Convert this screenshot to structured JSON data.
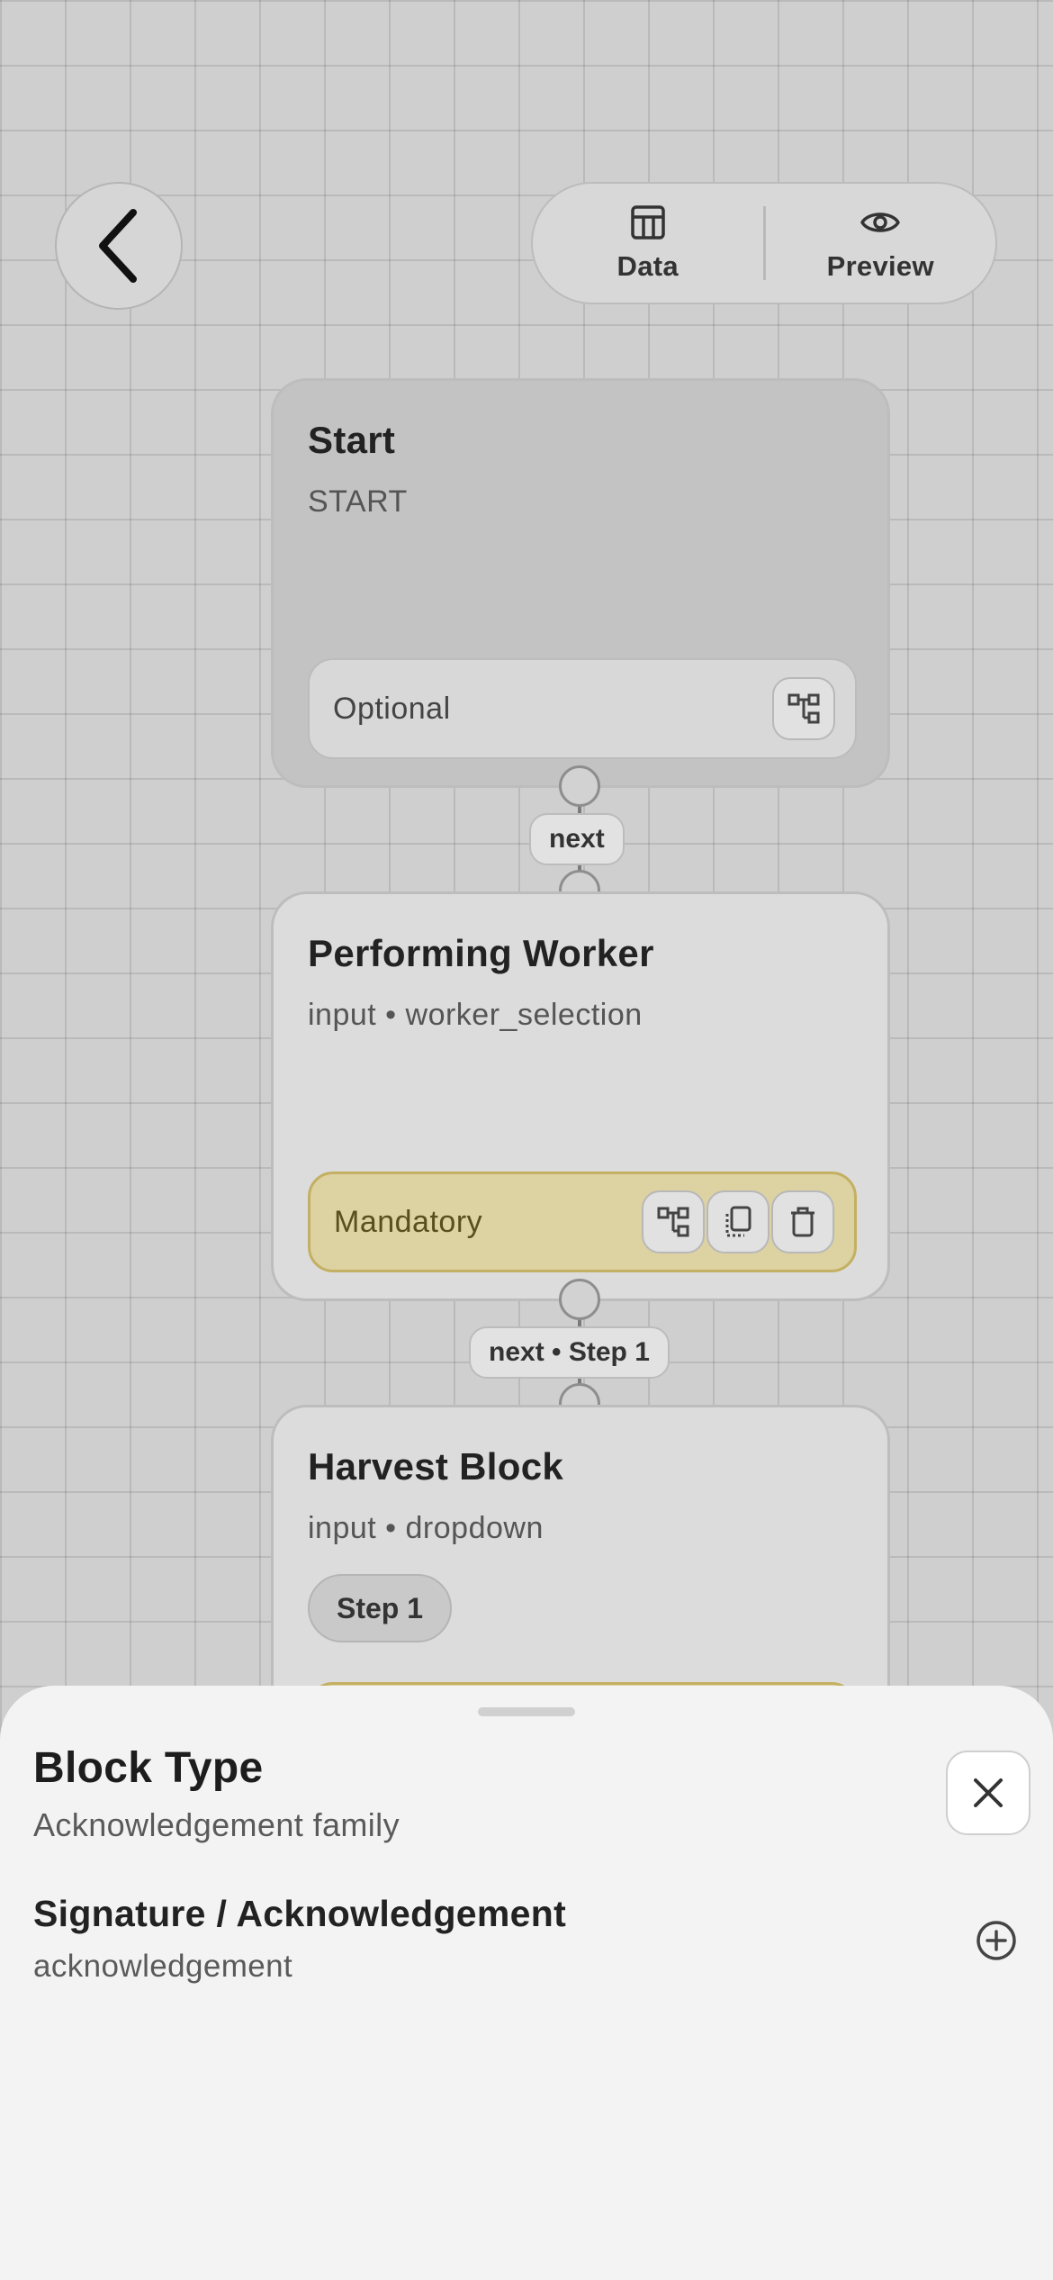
{
  "toolbar": {
    "back_icon": "chevron-left-icon",
    "data_label": "Data",
    "data_icon": "table-icon",
    "preview_label": "Preview",
    "preview_icon": "eye-icon"
  },
  "blocks": [
    {
      "title": "Start",
      "subtitle": "START",
      "footer_label": "Optional"
    },
    {
      "title": "Performing Worker",
      "subtitle": "input • worker_selection",
      "footer_label": "Mandatory"
    },
    {
      "title": "Harvest Block",
      "subtitle": "input • dropdown",
      "chip": "Step 1"
    }
  ],
  "edges": [
    {
      "label": "next"
    },
    {
      "label": "next • Step 1"
    }
  ],
  "colors": {
    "canvas_bg": "#cfcfcf",
    "start_block": "#c3c3c3",
    "block": "#dcdcdc",
    "mandatory_bg": "#dcd2a2",
    "mandatory_border": "#c4b062",
    "sheet_bg": "#f3f3f3"
  },
  "sheet": {
    "title": "Block Type",
    "subtitle": "Acknowledgement family",
    "close_icon": "close-icon",
    "options": [
      {
        "title": "Signature / Acknowledgement",
        "subtitle": "acknowledgement",
        "icon": "plus-circle-icon"
      }
    ]
  }
}
